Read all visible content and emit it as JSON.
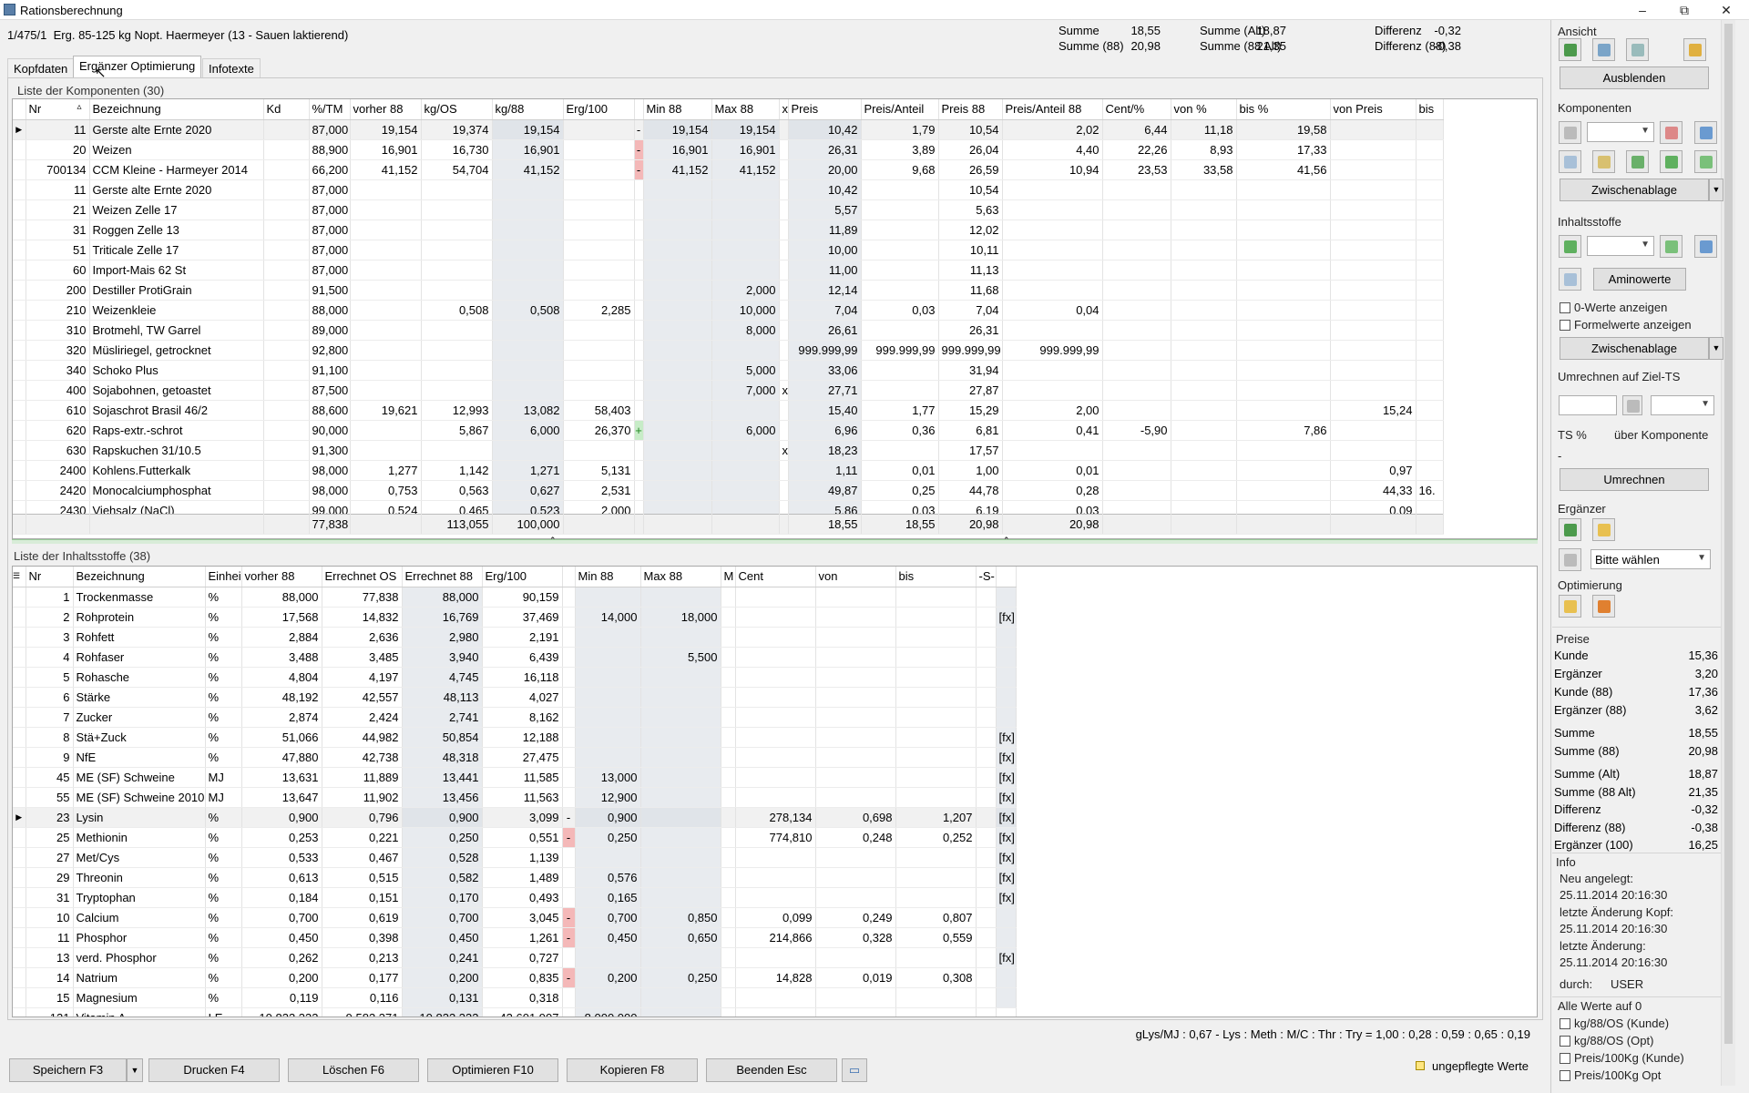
{
  "window": {
    "title": "Rationsberechnung",
    "min": "–",
    "max": "⧉",
    "close": "✕"
  },
  "header": {
    "id": "1/475/1",
    "name": "Erg. 85-125 kg Nopt. Haermeyer (13 - Sauen laktierend)",
    "summary": [
      [
        "Summe",
        "18,55",
        "Summe (Alt)",
        "18,87",
        "Differenz",
        "-0,32"
      ],
      [
        "Summe (88)",
        "20,98",
        "Summe (88 Alt)",
        "21,35",
        "Differenz (88)",
        "-0,38"
      ]
    ]
  },
  "tabs": [
    "Kopfdaten",
    "Ergänzer Optimierung",
    "Infotexte"
  ],
  "components": {
    "title": "Liste der Komponenten (30)",
    "columns": [
      "Nr",
      "Bezeichnung",
      "Kd",
      "%/TM",
      "vorher 88",
      "kg/OS",
      "kg/88",
      "Erg/100",
      "",
      "Min 88",
      "Max 88",
      "x",
      "Preis",
      "Preis/Anteil",
      "Preis 88",
      "Preis/Anteil 88",
      "Cent/%",
      "von %",
      "bis %",
      "von Preis",
      "bis"
    ],
    "rows": [
      [
        "11",
        "Gerste alte Ernte 2020",
        "",
        "87,000",
        "19,154",
        "19,374",
        "19,154",
        "",
        "-",
        "19,154",
        "19,154",
        "",
        "10,42",
        "1,79",
        "10,54",
        "2,02",
        "6,44",
        "11,18",
        "19,58",
        "",
        ""
      ],
      [
        "20",
        "Weizen",
        "",
        "88,900",
        "16,901",
        "16,730",
        "16,901",
        "",
        "-",
        "16,901",
        "16,901",
        "",
        "26,31",
        "3,89",
        "26,04",
        "4,40",
        "22,26",
        "8,93",
        "17,33",
        "",
        ""
      ],
      [
        "700134",
        "CCM Kleine - Harmeyer 2014",
        "",
        "66,200",
        "41,152",
        "54,704",
        "41,152",
        "",
        "-",
        "41,152",
        "41,152",
        "",
        "20,00",
        "9,68",
        "26,59",
        "10,94",
        "23,53",
        "33,58",
        "41,56",
        "",
        ""
      ],
      [
        "11",
        "Gerste alte Ernte 2020",
        "",
        "87,000",
        "",
        "",
        "",
        "",
        "",
        "",
        "",
        "",
        "10,42",
        "",
        "10,54",
        "",
        "",
        "",
        "",
        "",
        ""
      ],
      [
        "21",
        "Weizen Zelle 17",
        "",
        "87,000",
        "",
        "",
        "",
        "",
        "",
        "",
        "",
        "",
        "5,57",
        "",
        "5,63",
        "",
        "",
        "",
        "",
        "",
        ""
      ],
      [
        "31",
        "Roggen Zelle 13",
        "",
        "87,000",
        "",
        "",
        "",
        "",
        "",
        "",
        "",
        "",
        "11,89",
        "",
        "12,02",
        "",
        "",
        "",
        "",
        "",
        ""
      ],
      [
        "51",
        "Triticale Zelle 17",
        "",
        "87,000",
        "",
        "",
        "",
        "",
        "",
        "",
        "",
        "",
        "10,00",
        "",
        "10,11",
        "",
        "",
        "",
        "",
        "",
        ""
      ],
      [
        "60",
        "Import-Mais 62 St",
        "",
        "87,000",
        "",
        "",
        "",
        "",
        "",
        "",
        "",
        "",
        "11,00",
        "",
        "11,13",
        "",
        "",
        "",
        "",
        "",
        ""
      ],
      [
        "200",
        "Destiller ProtiGrain",
        "",
        "91,500",
        "",
        "",
        "",
        "",
        "",
        "",
        "2,000",
        "",
        "12,14",
        "",
        "11,68",
        "",
        "",
        "",
        "",
        "",
        ""
      ],
      [
        "210",
        "Weizenkleie",
        "",
        "88,000",
        "",
        "0,508",
        "0,508",
        "2,285",
        "",
        "",
        "10,000",
        "",
        "7,04",
        "0,03",
        "7,04",
        "0,04",
        "",
        "",
        "",
        "",
        ""
      ],
      [
        "310",
        "Brotmehl, TW Garrel",
        "",
        "89,000",
        "",
        "",
        "",
        "",
        "",
        "",
        "8,000",
        "",
        "26,61",
        "",
        "26,31",
        "",
        "",
        "",
        "",
        "",
        ""
      ],
      [
        "320",
        "Müsliriegel, getrocknet",
        "",
        "92,800",
        "",
        "",
        "",
        "",
        "",
        "",
        "",
        "",
        "999.999,99",
        "999.999,99",
        "999.999,99",
        "999.999,99",
        "",
        "",
        "",
        "",
        ""
      ],
      [
        "340",
        "Schoko Plus",
        "",
        "91,100",
        "",
        "",
        "",
        "",
        "",
        "",
        "5,000",
        "",
        "33,06",
        "",
        "31,94",
        "",
        "",
        "",
        "",
        "",
        ""
      ],
      [
        "400",
        "Sojabohnen, getoastet",
        "",
        "87,500",
        "",
        "",
        "",
        "",
        "",
        "",
        "7,000",
        "x",
        "27,71",
        "",
        "27,87",
        "",
        "",
        "",
        "",
        "",
        ""
      ],
      [
        "610",
        "Sojaschrot Brasil 46/2",
        "",
        "88,600",
        "19,621",
        "12,993",
        "13,082",
        "58,403",
        "",
        "",
        "",
        "",
        "15,40",
        "1,77",
        "15,29",
        "2,00",
        "",
        "",
        "",
        "15,24",
        ""
      ],
      [
        "620",
        "Raps-extr.-schrot",
        "",
        "90,000",
        "",
        "5,867",
        "6,000",
        "26,370",
        "+",
        "",
        "6,000",
        "",
        "6,96",
        "0,36",
        "6,81",
        "0,41",
        "-5,90",
        "",
        "7,86",
        "",
        ""
      ],
      [
        "630",
        "Rapskuchen 31/10.5",
        "",
        "91,300",
        "",
        "",
        "",
        "",
        "",
        "",
        "",
        "x",
        "18,23",
        "",
        "17,57",
        "",
        "",
        "",
        "",
        "",
        ""
      ],
      [
        "2400",
        "Kohlens.Futterkalk",
        "",
        "98,000",
        "1,277",
        "1,142",
        "1,271",
        "5,131",
        "",
        "",
        "",
        "",
        "1,11",
        "0,01",
        "1,00",
        "0,01",
        "",
        "",
        "",
        "0,97",
        ""
      ],
      [
        "2420",
        "Monocalciumphosphat",
        "",
        "98,000",
        "0,753",
        "0,563",
        "0,627",
        "2,531",
        "",
        "",
        "",
        "",
        "49,87",
        "0,25",
        "44,78",
        "0,28",
        "",
        "",
        "",
        "44,33",
        "16."
      ]
    ],
    "sums": {
      "tm": "77,838",
      "kgos": "113,055",
      "kg88": "100,000",
      "preis": "18,55",
      "anteil": "18,55",
      "preis88": "20,98",
      "anteil88": "20,98"
    }
  },
  "nutrients": {
    "title": "Liste der Inhaltsstoffe (38)",
    "columns": [
      "Nr",
      "Bezeichnung",
      "Einhei",
      "vorher 88",
      "Errechnet OS",
      "Errechnet 88",
      "Erg/100",
      "",
      "Min 88",
      "Max 88",
      "M",
      "Cent",
      "von",
      "bis",
      "-S-",
      ""
    ],
    "rows": [
      [
        "1",
        "Trockenmasse",
        "%",
        "88,000",
        "77,838",
        "88,000",
        "90,159",
        "",
        "",
        "",
        "",
        "",
        "",
        "",
        "",
        ""
      ],
      [
        "2",
        "Rohprotein",
        "%",
        "17,568",
        "14,832",
        "16,769",
        "37,469",
        "",
        "14,000",
        "18,000",
        "",
        "",
        "",
        "",
        "",
        "[fx]"
      ],
      [
        "3",
        "Rohfett",
        "%",
        "2,884",
        "2,636",
        "2,980",
        "2,191",
        "",
        "",
        "",
        "",
        "",
        "",
        "",
        "",
        ""
      ],
      [
        "4",
        "Rohfaser",
        "%",
        "3,488",
        "3,485",
        "3,940",
        "6,439",
        "",
        "",
        "5,500",
        "",
        "",
        "",
        "",
        "",
        ""
      ],
      [
        "5",
        "Rohasche",
        "%",
        "4,804",
        "4,197",
        "4,745",
        "16,118",
        "",
        "",
        "",
        "",
        "",
        "",
        "",
        "",
        ""
      ],
      [
        "6",
        "Stärke",
        "%",
        "48,192",
        "42,557",
        "48,113",
        "4,027",
        "",
        "",
        "",
        "",
        "",
        "",
        "",
        "",
        ""
      ],
      [
        "7",
        "Zucker",
        "%",
        "2,874",
        "2,424",
        "2,741",
        "8,162",
        "",
        "",
        "",
        "",
        "",
        "",
        "",
        "",
        ""
      ],
      [
        "8",
        "Stä+Zuck",
        "%",
        "51,066",
        "44,982",
        "50,854",
        "12,188",
        "",
        "",
        "",
        "",
        "",
        "",
        "",
        "",
        "[fx]"
      ],
      [
        "9",
        "NfE",
        "%",
        "47,880",
        "42,738",
        "48,318",
        "27,475",
        "",
        "",
        "",
        "",
        "",
        "",
        "",
        "",
        "[fx]"
      ],
      [
        "45",
        "ME (SF) Schweine",
        "MJ",
        "13,631",
        "11,889",
        "13,441",
        "11,585",
        "",
        "13,000",
        "",
        "",
        "",
        "",
        "",
        "",
        "[fx]"
      ],
      [
        "55",
        "ME (SF) Schweine 2010",
        "MJ",
        "13,647",
        "11,902",
        "13,456",
        "11,563",
        "",
        "12,900",
        "",
        "",
        "",
        "",
        "",
        "",
        "[fx]"
      ],
      [
        "23",
        "Lysin",
        "%",
        "0,900",
        "0,796",
        "0,900",
        "3,099",
        "-",
        "0,900",
        "",
        "",
        "278,134",
        "0,698",
        "1,207",
        "",
        "[fx]"
      ],
      [
        "25",
        "Methionin",
        "%",
        "0,253",
        "0,221",
        "0,250",
        "0,551",
        "-",
        "0,250",
        "",
        "",
        "774,810",
        "0,248",
        "0,252",
        "",
        "[fx]"
      ],
      [
        "27",
        "Met/Cys",
        "%",
        "0,533",
        "0,467",
        "0,528",
        "1,139",
        "",
        "",
        "",
        "",
        "",
        "",
        "",
        "",
        "[fx]"
      ],
      [
        "29",
        "Threonin",
        "%",
        "0,613",
        "0,515",
        "0,582",
        "1,489",
        "",
        "0,576",
        "",
        "",
        "",
        "",
        "",
        "",
        "[fx]"
      ],
      [
        "31",
        "Tryptophan",
        "%",
        "0,184",
        "0,151",
        "0,170",
        "0,493",
        "",
        "0,165",
        "",
        "",
        "",
        "",
        "",
        "",
        "[fx]"
      ],
      [
        "10",
        "Calcium",
        "%",
        "0,700",
        "0,619",
        "0,700",
        "3,045",
        "-",
        "0,700",
        "0,850",
        "",
        "0,099",
        "0,249",
        "0,807",
        "",
        ""
      ],
      [
        "11",
        "Phosphor",
        "%",
        "0,450",
        "0,398",
        "0,450",
        "1,261",
        "-",
        "0,450",
        "0,650",
        "",
        "214,866",
        "0,328",
        "0,559",
        "",
        ""
      ],
      [
        "13",
        "verd. Phosphor",
        "%",
        "0,262",
        "0,213",
        "0,241",
        "0,727",
        "",
        "",
        "",
        "",
        "",
        "",
        "",
        "",
        "[fx]"
      ],
      [
        "14",
        "Natrium",
        "%",
        "0,200",
        "0,177",
        "0,200",
        "0,835",
        "-",
        "0,200",
        "0,250",
        "",
        "14,828",
        "0,019",
        "0,308",
        "",
        ""
      ],
      [
        "15",
        "Magnesium",
        "%",
        "0,119",
        "0,116",
        "0,131",
        "0,318",
        "",
        "",
        "",
        "",
        "",
        "",
        "",
        "",
        ""
      ]
    ]
  },
  "statusline": "gLys/MJ : 0,67  - Lys : Meth : M/C : Thr : Try = 1,00 : 0,28 : 0,59 : 0,65 : 0,19",
  "bottom_buttons": [
    "Speichern F3",
    "Drucken F4",
    "Löschen F6",
    "Optimieren F10",
    "Kopieren F8",
    "Beenden Esc"
  ],
  "legend": "ungepflegte Werte",
  "right": {
    "ansicht": "Ansicht",
    "ausblenden": "Ausblenden",
    "komponenten": "Komponenten",
    "zwischenablage": "Zwischenablage",
    "inhaltsstoffe": "Inhaltsstoffe",
    "aminowerte": "Aminowerte",
    "chk0": "0-Werte anzeigen",
    "chkF": "Formelwerte anzeigen",
    "zwischenablage2": "Zwischenablage",
    "umrechnen_title": "Umrechnen auf Ziel-TS",
    "ts": "TS %",
    "ueber": "über Komponente",
    "dash": "-",
    "umrechnen": "Umrechnen",
    "ergaenzer": "Ergänzer",
    "bitte": "Bitte wählen",
    "optimierung": "Optimierung",
    "preise": "Preise",
    "prices": [
      [
        "Kunde",
        "15,36"
      ],
      [
        "Ergänzer",
        "3,20"
      ],
      [
        "Kunde (88)",
        "17,36"
      ],
      [
        "Ergänzer (88)",
        "3,62"
      ],
      [
        "Summe",
        "18,55"
      ],
      [
        "Summe (88)",
        "20,98"
      ],
      [
        "Summe (Alt)",
        "18,87"
      ],
      [
        "Summe (88 Alt)",
        "21,35"
      ],
      [
        "Differenz",
        "-0,32"
      ],
      [
        "Differenz (88)",
        "-0,38"
      ],
      [
        "Ergänzer (100)",
        "16,25"
      ]
    ],
    "info": "Info",
    "neu": "Neu angelegt:",
    "neu_d": "25.11.2014 20:16:30",
    "lk": "letzte Änderung Kopf:",
    "lk_d": "25.11.2014 20:16:30",
    "la": "letzte Änderung:",
    "la_d": "25.11.2014 20:16:30",
    "durch": "durch:",
    "user": "USER",
    "alle": "Alle Werte auf 0",
    "opts": [
      "kg/88/OS (Kunde)",
      "kg/88/OS (Opt)",
      "Preis/100Kg (Kunde)",
      "Preis/100Kg Opt"
    ]
  }
}
